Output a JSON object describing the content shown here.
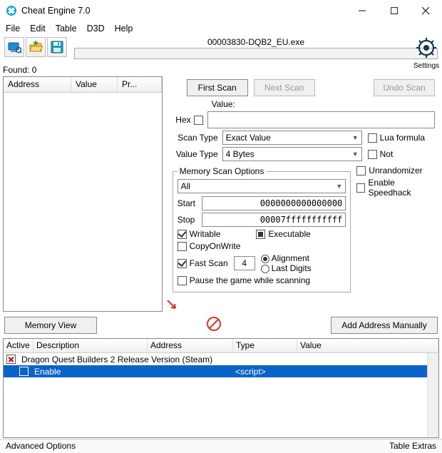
{
  "window": {
    "title": "Cheat Engine 7.0"
  },
  "menu": {
    "file": "File",
    "edit": "Edit",
    "table": "Table",
    "d3d": "D3D",
    "help": "Help"
  },
  "process": {
    "name": "00003830-DQB2_EU.exe"
  },
  "settings_label": "Settings",
  "found": {
    "label": "Found: 0"
  },
  "list_cols": {
    "address": "Address",
    "value": "Value",
    "prev": "Pr..."
  },
  "buttons": {
    "first_scan": "First Scan",
    "next_scan": "Next Scan",
    "undo_scan": "Undo Scan",
    "memory_view": "Memory View",
    "add_manual": "Add Address Manually"
  },
  "labels": {
    "value": "Value:",
    "hex": "Hex",
    "scan_type": "Scan Type",
    "value_type": "Value Type",
    "lua_formula": "Lua formula",
    "not": "Not",
    "mso": "Memory Scan Options",
    "unrandomizer": "Unrandomizer",
    "speedhack": "Enable Speedhack",
    "start": "Start",
    "stop": "Stop",
    "writable": "Writable",
    "executable": "Executable",
    "copyonwrite": "CopyOnWrite",
    "fast_scan": "Fast Scan",
    "alignment": "Alignment",
    "last_digits": "Last Digits",
    "pause": "Pause the game while scanning"
  },
  "values": {
    "scan_type": "Exact Value",
    "value_type": "4 Bytes",
    "mso_region": "All",
    "start": "0000000000000000",
    "stop": "00007fffffffffff",
    "fast": "4",
    "value_input": ""
  },
  "table": {
    "headers": {
      "active": "Active",
      "desc": "Description",
      "address": "Address",
      "type": "Type",
      "value": "Value"
    },
    "rows": [
      {
        "active_state": "x",
        "desc": "Dragon Quest Builders 2 Release Version (Steam)",
        "address": "",
        "type": "",
        "value": "",
        "selected": false
      },
      {
        "active_state": "",
        "desc": "Enable",
        "address": "",
        "type": "<script>",
        "value": "",
        "selected": true,
        "indent": true
      }
    ]
  },
  "status": {
    "left": "Advanced Options",
    "right": "Table Extras"
  }
}
